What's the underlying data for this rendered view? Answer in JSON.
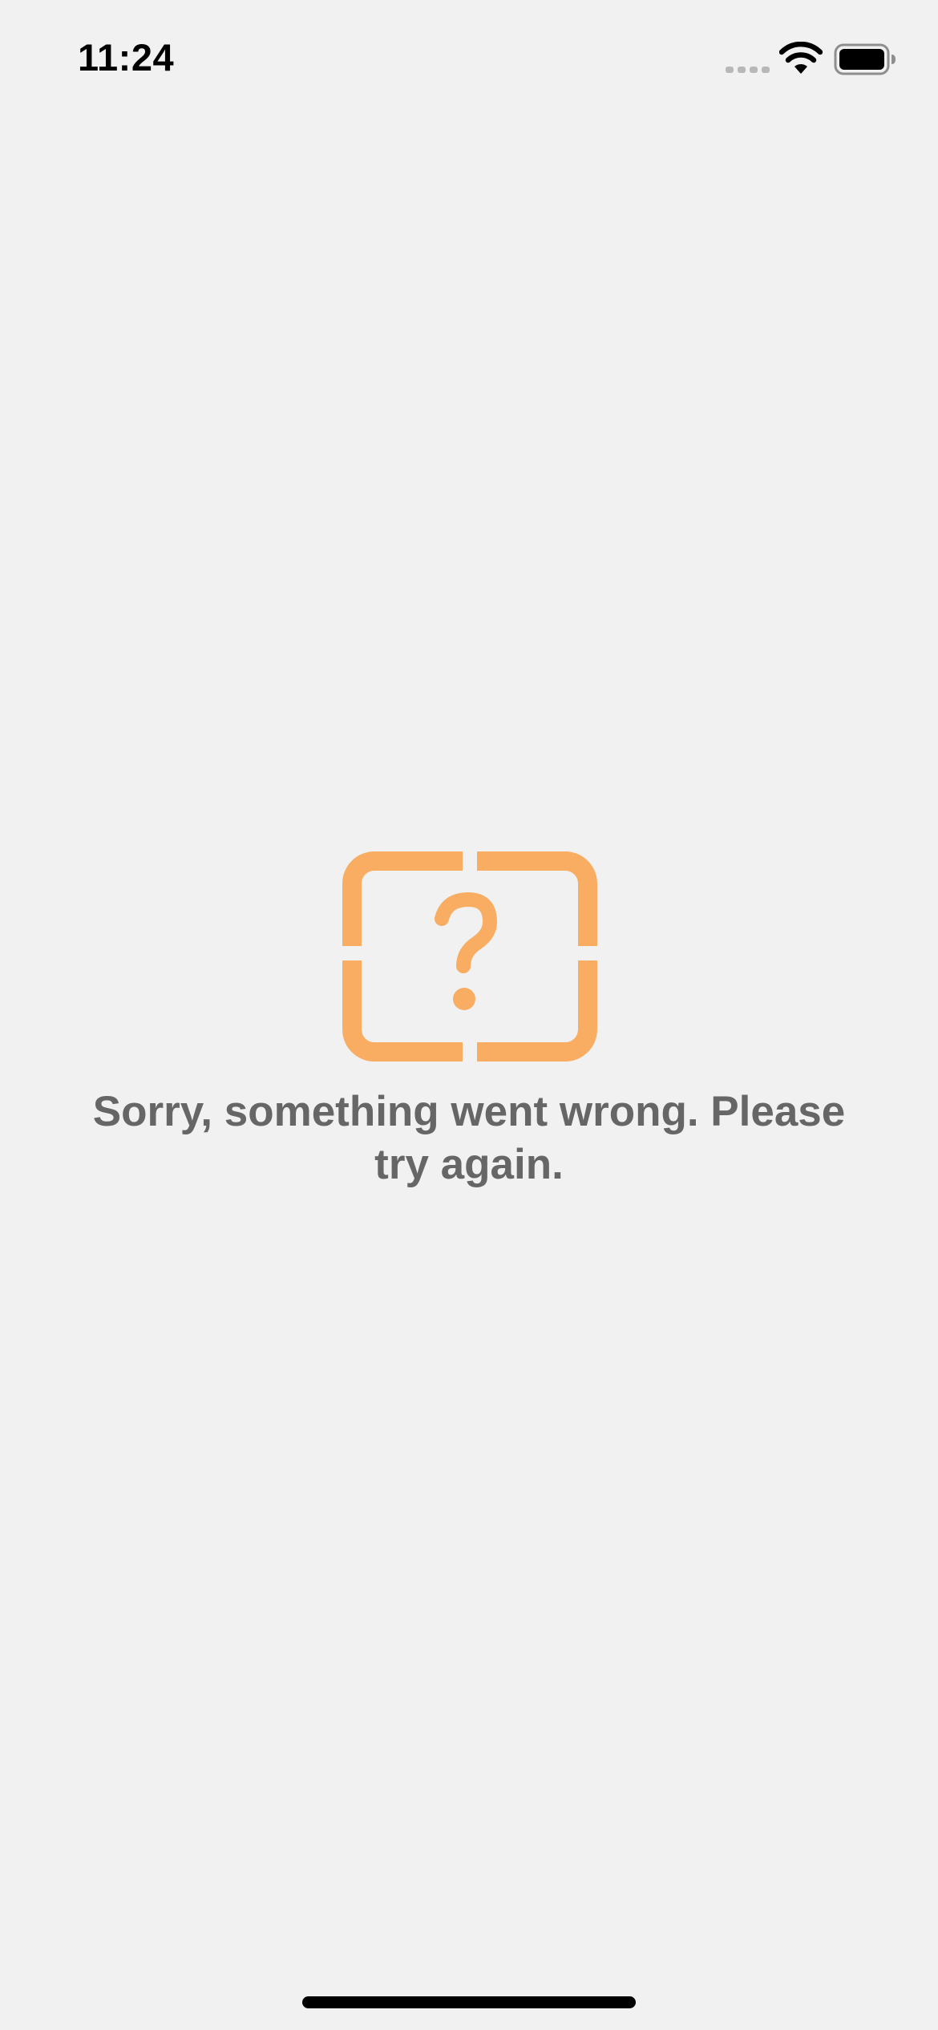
{
  "status_bar": {
    "time": "11:24",
    "icons": [
      "cellular-signal-icon",
      "wifi-icon",
      "battery-icon"
    ]
  },
  "error": {
    "icon": "question-mark-frame-icon",
    "icon_color": "#f8ad63",
    "message": "Sorry, something went wrong. Please try again."
  },
  "colors": {
    "background": "#f1f1f1",
    "text": "#666666"
  }
}
